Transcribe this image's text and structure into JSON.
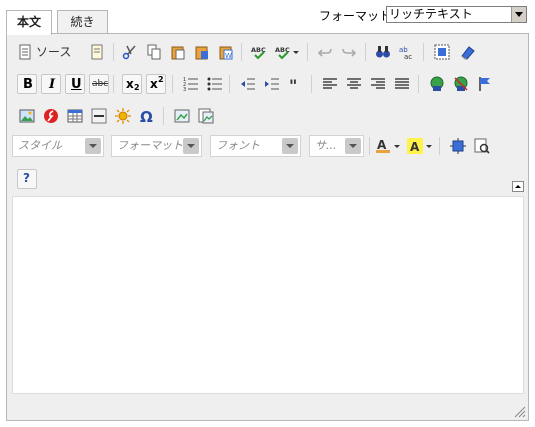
{
  "tabs": [
    {
      "label": "本文",
      "active": true
    },
    {
      "label": "続き",
      "active": false
    }
  ],
  "format": {
    "label": "フォーマット:",
    "selected": "リッチテキスト"
  },
  "toolbar": {
    "source_label": "ソース",
    "combos": {
      "style": "スタイル",
      "format": "フォーマット",
      "font": "フォント",
      "size": "サ..."
    },
    "bold": "B",
    "italic": "I",
    "underline": "U",
    "strike": "abc",
    "subscript": "x",
    "subscript_mark": "2",
    "superscript": "x",
    "superscript_mark": "2",
    "spellcheck": "ABC",
    "help": "?"
  },
  "editor": {
    "content": ""
  }
}
